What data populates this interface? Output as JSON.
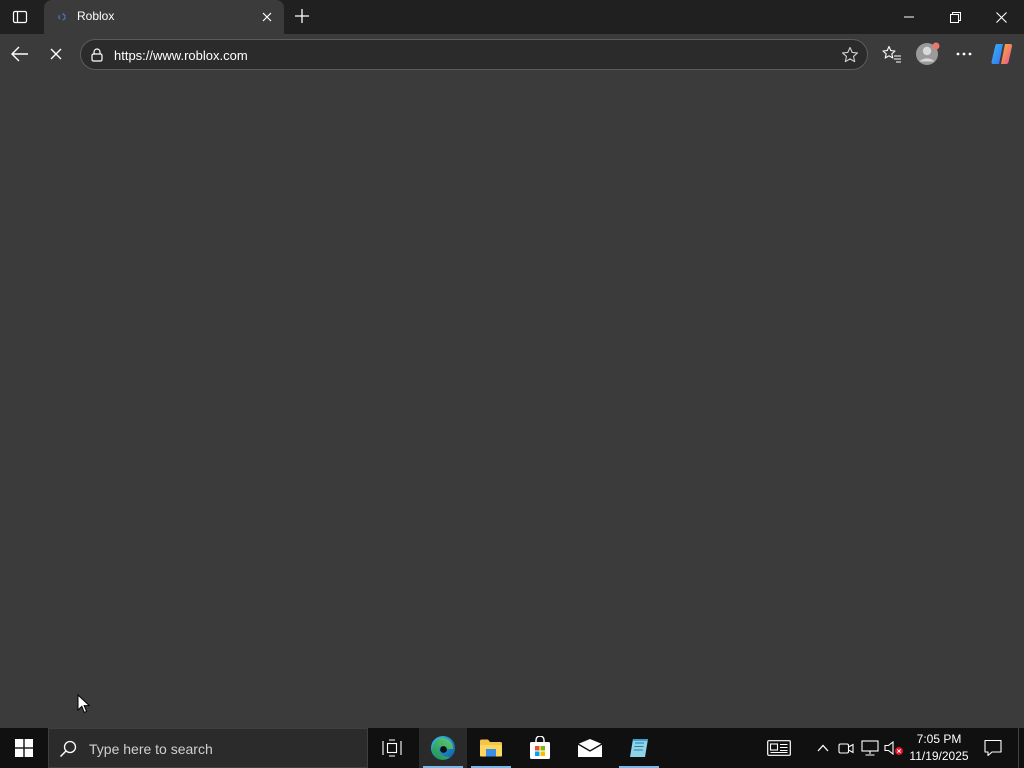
{
  "browser": {
    "tab_title": "Roblox",
    "url": "https://www.roblox.com"
  },
  "taskbar": {
    "search_placeholder": "Type here to search",
    "time": "7:05 PM",
    "date": "11/19/2025"
  },
  "icons": {
    "tab_actions": "tab-actions-icon",
    "favicon": "roblox-favicon-icon",
    "tab_close": "close-icon",
    "new_tab": "plus-icon",
    "minimize": "minimize-icon",
    "restore": "restore-icon",
    "close_window": "close-icon",
    "back": "back-arrow-icon",
    "stop": "stop-loading-icon",
    "lock": "site-info-icon",
    "favorite": "star-icon",
    "favorites": "favorites-icon",
    "profile": "profile-avatar-icon",
    "menu": "more-icon",
    "copilot": "copilot-icon",
    "start": "windows-start-icon",
    "search": "search-icon",
    "task_view": "task-view-icon",
    "edge": "edge-browser-icon",
    "file_explorer": "folder-icon",
    "store": "store-icon",
    "mail": "mail-icon",
    "notepad": "notepad-icon",
    "news": "news-widget-icon",
    "chevron_up": "chevron-up-icon",
    "meet_now": "camera-icon",
    "network": "network-icon",
    "volume": "volume-muted-icon",
    "notifications": "notification-icon"
  },
  "colors": {
    "titlebar": "#202020",
    "page_background": "#3b3b3b",
    "taskbar": "#101010",
    "accent": "#76b9ed"
  }
}
